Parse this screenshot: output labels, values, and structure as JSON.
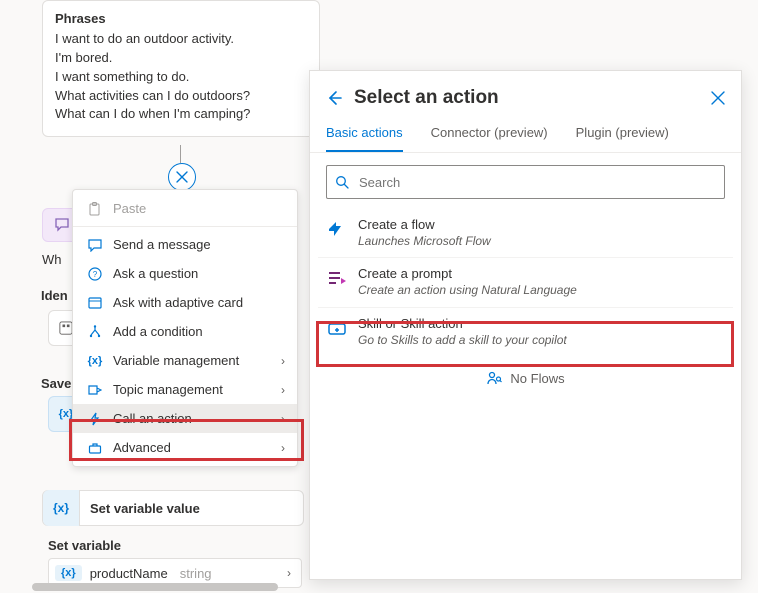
{
  "phrases_card": {
    "title": "Phrases",
    "items": [
      "I want to do an outdoor activity.",
      "I'm bored.",
      "I want something to do.",
      "What activities can I do outdoors?",
      "What can I do when I'm camping?"
    ]
  },
  "partial_labels": {
    "wh": "Wh",
    "iden": "Iden",
    "save": "Save"
  },
  "context_menu": {
    "paste": "Paste",
    "send": "Send a message",
    "ask": "Ask a question",
    "adaptive": "Ask with adaptive card",
    "cond": "Add a condition",
    "varmgmt": "Variable management",
    "topmgmt": "Topic management",
    "call": "Call an action",
    "adv": "Advanced"
  },
  "set_variable": {
    "node_label": "Set variable value",
    "section_label": "Set variable",
    "var_name": "productName",
    "var_type": "string"
  },
  "panel": {
    "title": "Select an action",
    "tabs": {
      "basic": "Basic actions",
      "connector": "Connector (preview)",
      "plugin": "Plugin (preview)"
    },
    "search_placeholder": "Search",
    "actions": {
      "flow": {
        "t": "Create a flow",
        "d": "Launches Microsoft Flow"
      },
      "prompt": {
        "t": "Create a prompt",
        "d": "Create an action using Natural Language"
      },
      "skill": {
        "t": "Skill or Skill action",
        "d": "Go to Skills to add a skill to your copilot"
      }
    },
    "no_flows": "No Flows"
  }
}
